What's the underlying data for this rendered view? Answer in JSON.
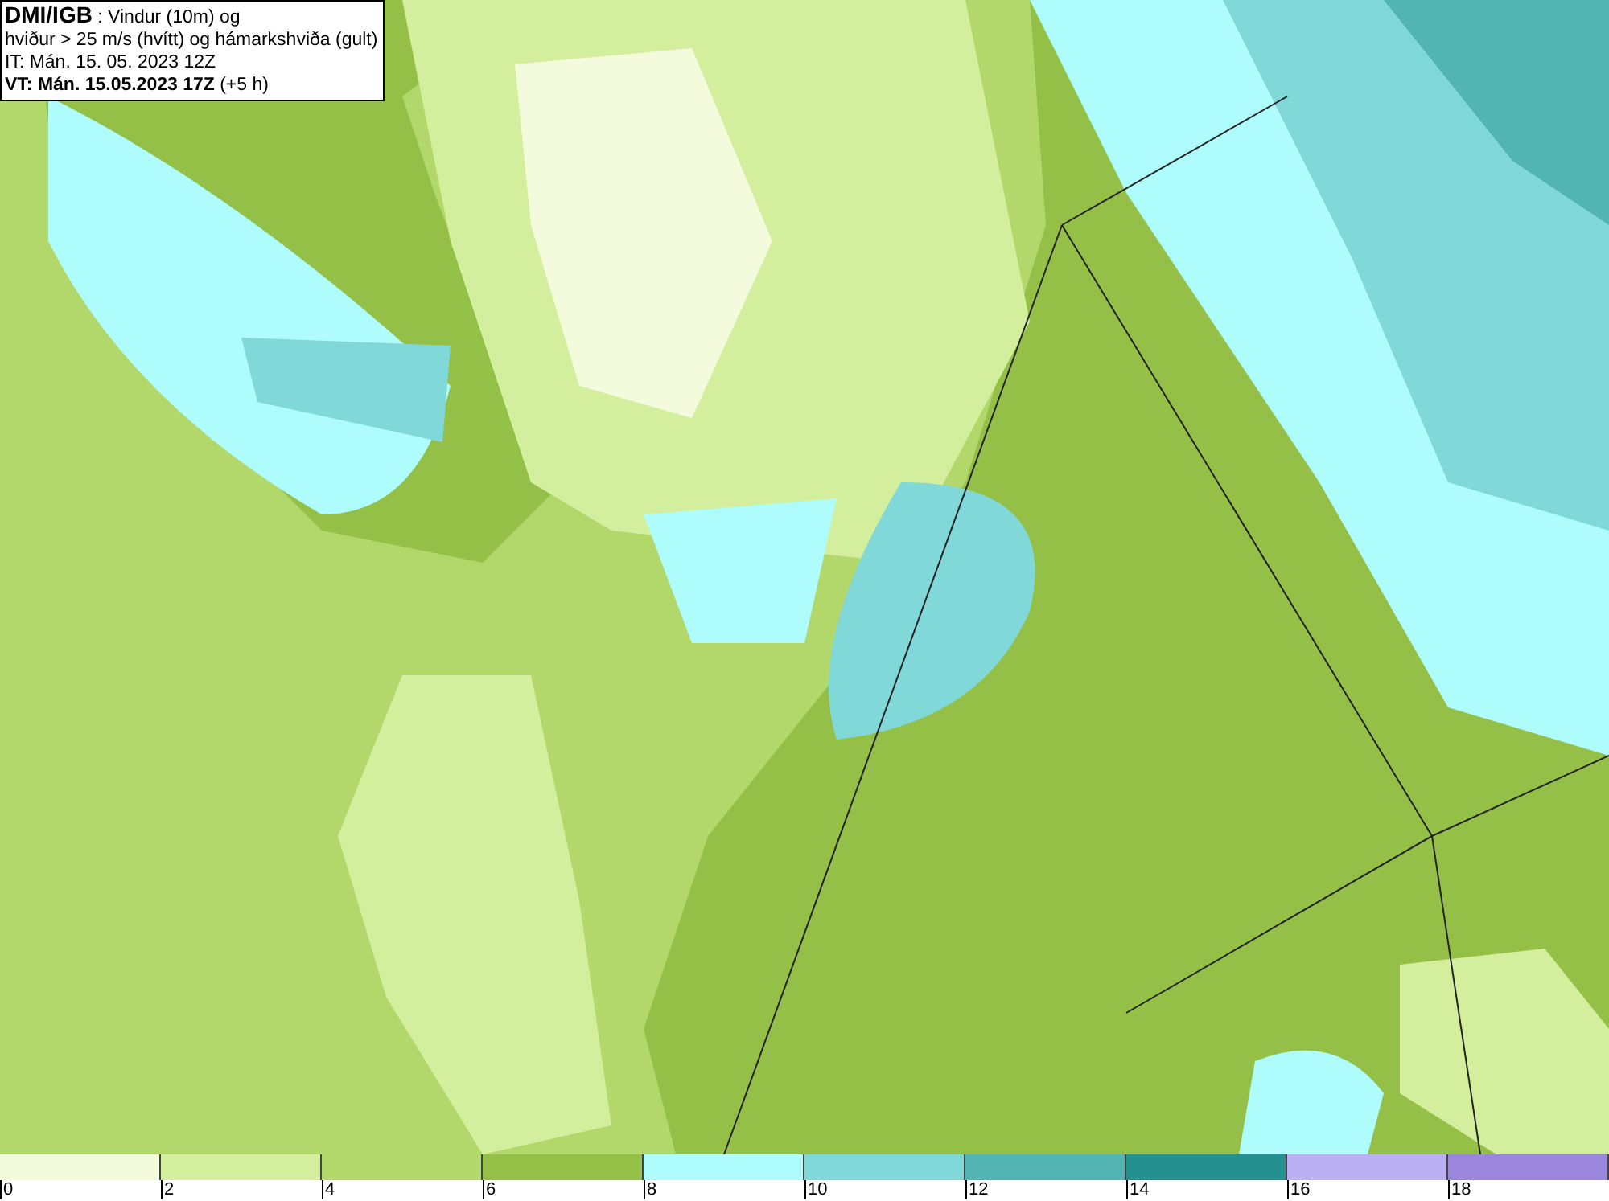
{
  "info_box": {
    "lines": [
      "**DMI/IGB** : Vindur (10m) og",
      "hviður > 25 m/s (hvítt) og hámarkshviða (gult)",
      "IT: Mán. 15. 05. 2023 12Z",
      "**VT: Mán. 15.05.2023 17Z** (+5 h)"
    ]
  },
  "legend": [
    {
      "color": "#f4fbdc",
      "label": "0"
    },
    {
      "color": "#d3ee9c",
      "label": "2"
    },
    {
      "color": "#b2d86c",
      "label": "4"
    },
    {
      "color": "#95c048",
      "label": "6"
    },
    {
      "color": "#aefcfc",
      "label": "8"
    },
    {
      "color": "#80d8d8",
      "label": "10"
    },
    {
      "color": "#53b4b4",
      "label": "12"
    },
    {
      "color": "#259090",
      "label": "14"
    },
    {
      "color": "#bcb0f4",
      "label": "16"
    },
    {
      "color": "#9a86dc",
      "label": "18"
    }
  ]
}
